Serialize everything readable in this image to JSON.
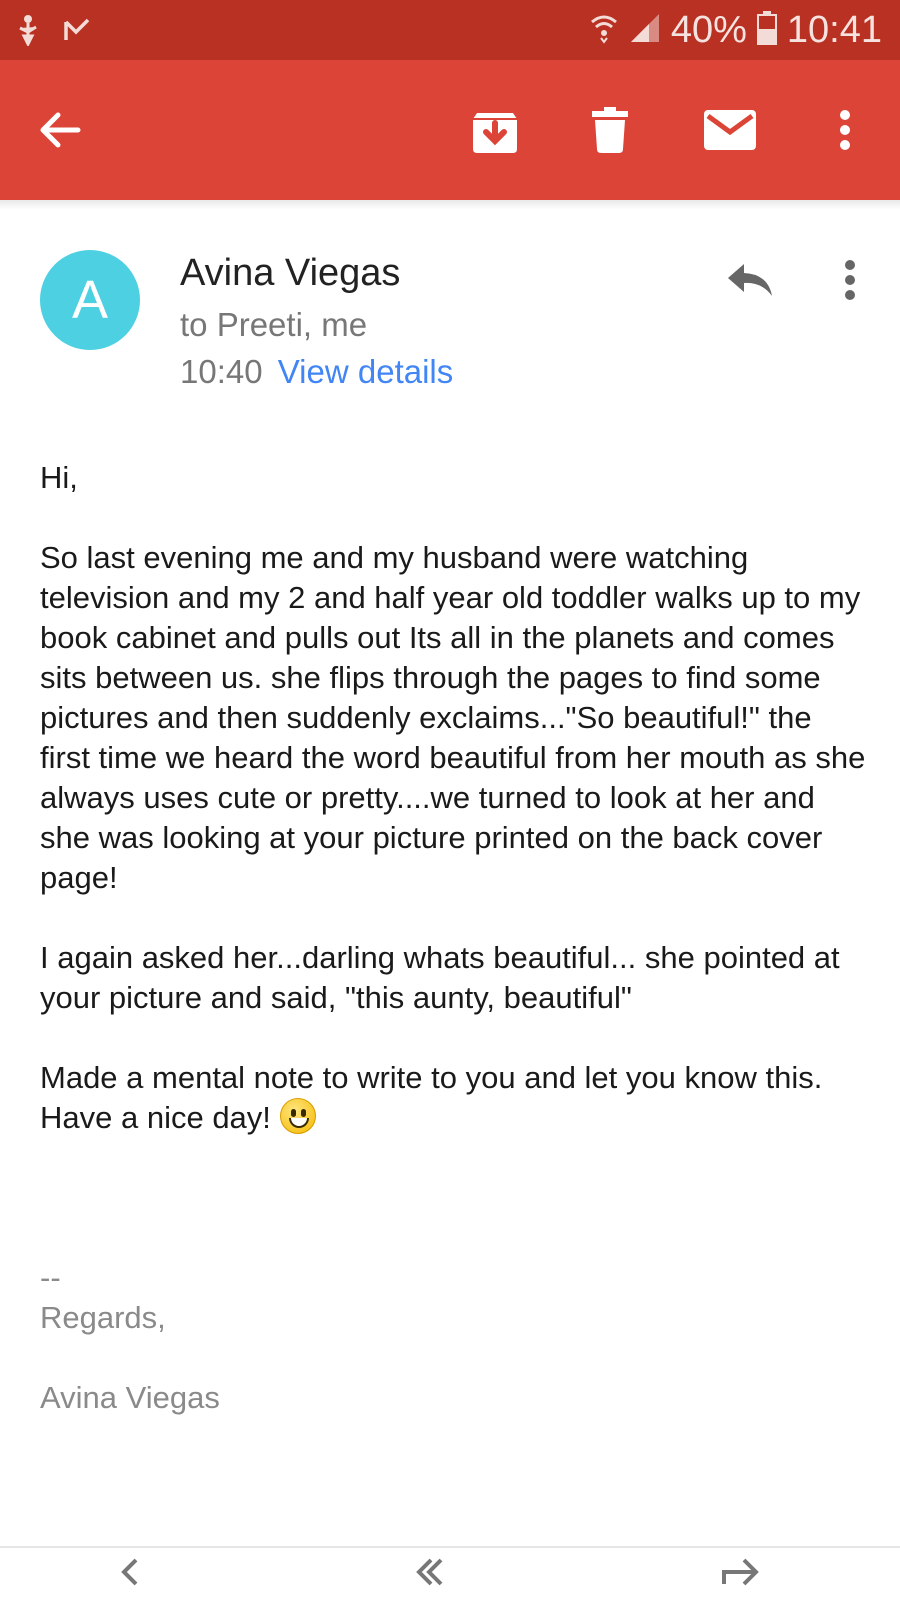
{
  "status_bar": {
    "battery_percent": "40%",
    "time": "10:41",
    "icons": [
      "usb-debug-icon",
      "missed-check-icon",
      "wifi-icon",
      "signal-icon",
      "battery-icon"
    ]
  },
  "app_bar": {
    "icons": [
      "back-arrow-icon",
      "archive-icon",
      "delete-icon",
      "mark-unread-icon",
      "more-vert-icon"
    ]
  },
  "email": {
    "avatar_letter": "A",
    "avatar_color": "#4dd0e1",
    "sender": "Avina Viegas",
    "recipients": "to Preeti, me",
    "time": "10:40",
    "view_details": "View details",
    "body": [
      "Hi,",
      "So last evening me and my husband were watching television and my 2 and half year old toddler walks up to my book cabinet and pulls out Its all in the planets and comes sits between us. she flips through the pages to find some pictures and then suddenly exclaims...\"So beautiful!\" the first time we heard the word beautiful from her mouth as she always uses cute or pretty....we turned to look at her and she was looking at your picture printed on the back cover page!",
      "I again asked her...darling whats beautiful... she pointed at your picture and said, \"this aunty, beautiful\"",
      "Made a mental note to write to you and let you know this. Have a nice day!"
    ],
    "signature": {
      "dashes": "--",
      "regards": "Regards,",
      "name": "Avina Viegas"
    }
  },
  "colors": {
    "status_bar": "#b93122",
    "app_bar": "#db4437",
    "link": "#4285f4"
  }
}
